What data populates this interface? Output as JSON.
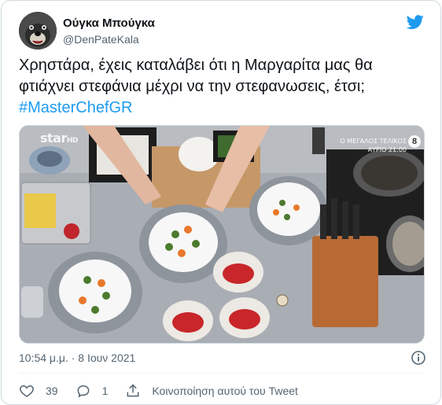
{
  "user": {
    "display_name": "Ούγκα Μπούγκα",
    "handle": "@DenPateKala",
    "avatar_icon": "dog-avatar-icon"
  },
  "platform_icon": "twitter-bird-icon",
  "colors": {
    "brand": "#1d9bf0",
    "text": "#0f1419",
    "muted": "#536471",
    "border": "#cfd9de"
  },
  "tweet": {
    "line1": "Χρηστάρα, έχεις καταλάβει ότι η Μαργαρίτα μας θα",
    "line2": "φτιάχνει στεφάνια μέχρι να την στεφανωσεις, έτσι;",
    "hashtag": "#MasterChefGR"
  },
  "media": {
    "logo": "star",
    "logo_suffix": "HD",
    "overlay_line1": "Ο ΜΕΓΑΛΟΣ ΤΕΛΙΚΟΣ",
    "overlay_line2": "ΑΥΡΙΟ 21:00",
    "overlay_badge": "8"
  },
  "timestamp": "10:54 μ.μ. · 8 Ιουν 2021",
  "actions": {
    "likes": "39",
    "replies": "1",
    "share_label": "Κοινοποίηση αυτού του Tweet"
  }
}
